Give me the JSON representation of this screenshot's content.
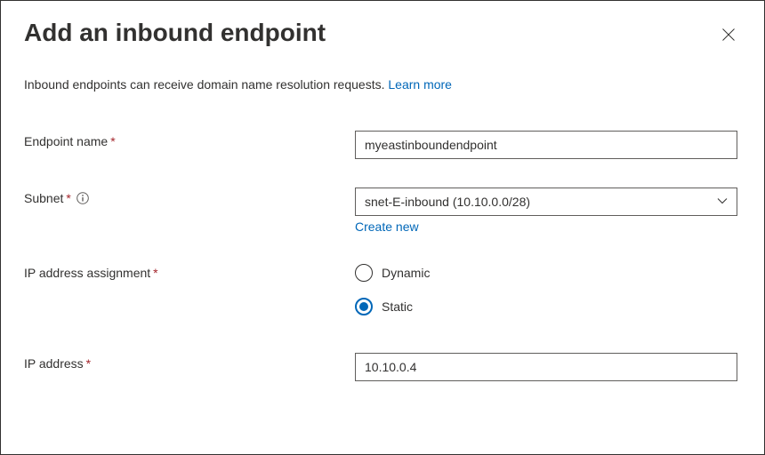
{
  "header": {
    "title": "Add an inbound endpoint"
  },
  "description": {
    "text": "Inbound endpoints can receive domain name resolution requests. ",
    "learn_more": "Learn more"
  },
  "form": {
    "endpoint_name": {
      "label": "Endpoint name",
      "value": "myeastinboundendpoint"
    },
    "subnet": {
      "label": "Subnet",
      "value": "snet-E-inbound (10.10.0.0/28)",
      "create_new": "Create new"
    },
    "ip_assignment": {
      "label": "IP address assignment",
      "options": {
        "dynamic": "Dynamic",
        "static": "Static"
      },
      "selected": "static"
    },
    "ip_address": {
      "label": "IP address",
      "value": "10.10.0.4"
    }
  }
}
